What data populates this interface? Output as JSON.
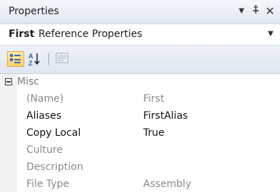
{
  "panel": {
    "title": "Properties",
    "dropdown_icon": "dropdown-triangle",
    "pin_icon": "pin-icon",
    "close_icon": "close-icon"
  },
  "selector": {
    "object_name": "First",
    "object_type": "Reference Properties"
  },
  "toolbar": {
    "categorized_icon": "categorized-icon",
    "alphabetical_icon": "alphabetical-sort-icon",
    "property_pages_icon": "property-pages-icon"
  },
  "grid": {
    "category": "Misc",
    "properties": [
      {
        "name": "(Name)",
        "value": "First",
        "enabled": false
      },
      {
        "name": "Aliases",
        "value": "FirstAlias",
        "enabled": true
      },
      {
        "name": "Copy Local",
        "value": "True",
        "enabled": true
      },
      {
        "name": "Culture",
        "value": "",
        "enabled": false
      },
      {
        "name": "Description",
        "value": "",
        "enabled": false
      },
      {
        "name": "File Type",
        "value": "Assembly",
        "enabled": false
      }
    ]
  },
  "colors": {
    "titlebar_top": "#f4f7fb",
    "titlebar_bottom": "#e1e8f2",
    "active_tool": "#ffd26b",
    "disabled_text": "#8a8a8a"
  }
}
